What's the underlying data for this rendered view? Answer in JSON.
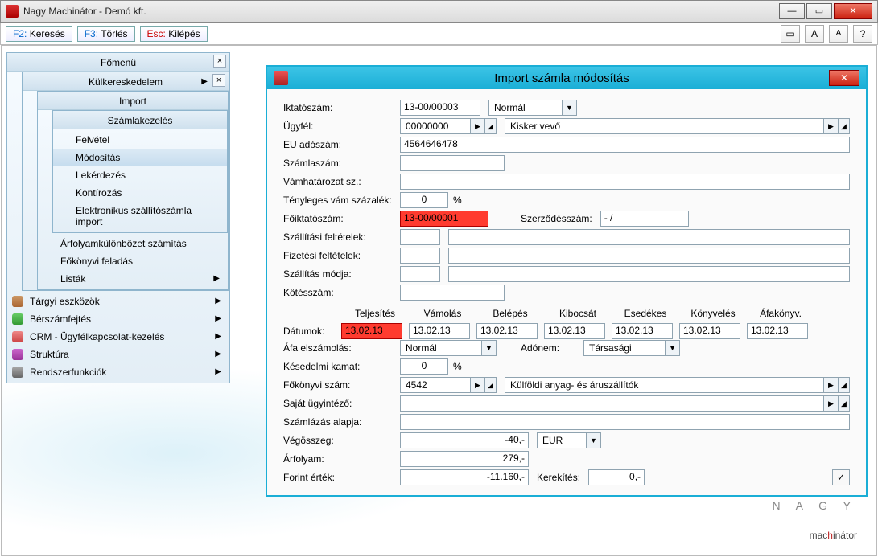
{
  "window": {
    "title": "Nagy Machinátor - Demó kft."
  },
  "toolbar": {
    "f2_key": "F2:",
    "f2_label": "Keresés",
    "f3_key": "F3:",
    "f3_label": "Törlés",
    "esc_key": "Esc:",
    "esc_label": "Kilépés",
    "a1": "A",
    "a2": "A",
    "q": "?"
  },
  "menus": {
    "l1": "Főmenü",
    "l2": "Külkereskedelem",
    "l3": "Import",
    "l4": "Számlakezelés",
    "l4_items": [
      "Felvétel",
      "Módosítás",
      "Lekérdezés",
      "Kontírozás",
      "Elektronikus szállítószámla import"
    ],
    "l3_items": [
      "Árfolyamkülönbözet számítás",
      "Főkönyvi feladás",
      "Listák"
    ],
    "l1_items": [
      "Tárgyi eszközök",
      "Bérszámfejtés",
      "CRM - Ügyfélkapcsolat-kezelés",
      "Struktúra",
      "Rendszerfunkciók"
    ]
  },
  "dialog": {
    "title": "Import számla módosítás",
    "labels": {
      "iktato": "Iktatószám:",
      "ugyfel": "Ügyfél:",
      "euado": "EU adószám:",
      "szamla": "Számlaszám:",
      "vamhat": "Vámhatározat sz.:",
      "tenyvam": "Tényleges vám százalék:",
      "foiktato": "Főiktatószám:",
      "szerz": "Szerződésszám:",
      "szallfelt": "Szállítási feltételek:",
      "fizfelt": "Fizetési feltételek:",
      "szallmod": "Szállítás módja:",
      "kotes": "Kötésszám:",
      "datumok": "Dátumok:",
      "afaelsz": "Áfa elszámolás:",
      "adonem": "Adónem:",
      "kesedelmi": "Késedelmi kamat:",
      "fokonyv": "Főkönyvi szám:",
      "ugyintezo": "Saját ügyintéző:",
      "szamlazas": "Számlázás alapja:",
      "vegosszeg": "Végösszeg:",
      "arfolyam": "Árfolyam:",
      "forint": "Forint érték:",
      "kerekites": "Kerekítés:"
    },
    "dates_hdr": [
      "Teljesítés",
      "Vámolás",
      "Belépés",
      "Kibocsát",
      "Esedékes",
      "Könyvelés",
      "Áfakönyv."
    ],
    "values": {
      "iktato": "13-00/00003",
      "status": "Normál",
      "ugyfel_code": "00000000",
      "ugyfel_name": "Kisker vevő",
      "euado": "4564646478",
      "szamla": "",
      "vamhat": "",
      "tenyvam": "0",
      "pct": "%",
      "foiktato": "13-00/00001",
      "szerz": "-  /",
      "szallfelt1": "",
      "szallfelt2": "",
      "fizfelt1": "",
      "fizfelt2": "",
      "szallmod1": "",
      "szallmod2": "",
      "kotes": "",
      "dates": [
        "13.02.13",
        "13.02.13",
        "13.02.13",
        "13.02.13",
        "13.02.13",
        "13.02.13",
        "13.02.13"
      ],
      "afaelsz": "Normál",
      "adonem": "Társasági",
      "kesedelmi": "0",
      "fokonyv_code": "4542",
      "fokonyv_name": "Külföldi anyag- és áruszállítók",
      "ugyintezo": "",
      "szamlazas": "",
      "vegosszeg": "-40,-",
      "currency": "EUR",
      "arfolyam": "279,-",
      "forint": "-11.160,-",
      "kerekites": "0,-"
    }
  },
  "logo": {
    "top": "N A G Y",
    "pre": "mac",
    "h": "h",
    "post": "inátor"
  }
}
